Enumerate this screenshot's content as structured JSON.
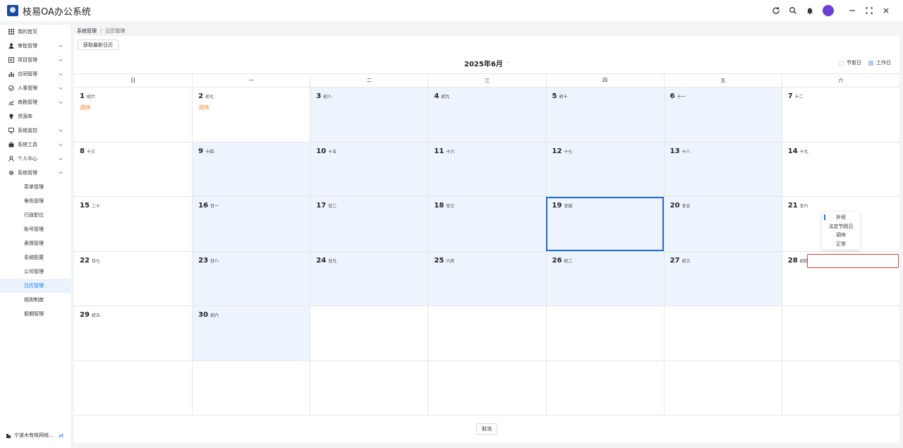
{
  "app": {
    "title": "枝易OA办公系统",
    "logo_icon": "app-logo-icon"
  },
  "topbar": {
    "icons": [
      "refresh-icon",
      "search-icon",
      "bell-icon",
      "user-avatar",
      "minimize-icon",
      "maximize-icon",
      "close-icon"
    ]
  },
  "sidebar": {
    "items": [
      {
        "label": "我的首页",
        "icon": "grid-icon",
        "expandable": false
      },
      {
        "label": "审批管理",
        "icon": "user-icon",
        "expandable": true
      },
      {
        "label": "项目管理",
        "icon": "project-icon",
        "expandable": true
      },
      {
        "label": "合同管理",
        "icon": "chart-icon",
        "expandable": true
      },
      {
        "label": "人事管理",
        "icon": "check-circle-icon",
        "expandable": true
      },
      {
        "label": "商務管理",
        "icon": "growth-chart-icon",
        "expandable": true
      },
      {
        "label": "资源库",
        "icon": "bulb-icon",
        "expandable": false
      },
      {
        "label": "系统监控",
        "icon": "monitor-icon",
        "expandable": true
      },
      {
        "label": "系统工具",
        "icon": "toolbox-icon",
        "expandable": true
      },
      {
        "label": "个人中心",
        "icon": "person-icon",
        "expandable": true
      },
      {
        "label": "系统管理",
        "icon": "gear-icon",
        "expandable": true,
        "expanded": true
      }
    ],
    "sub_items": [
      "菜单管理",
      "角色管理",
      "行政职位",
      "账号管理",
      "表情管理",
      "系统配置",
      "公司管理",
      "日历管理",
      "规则制度",
      "假期管理"
    ],
    "active_sub": "日历管理",
    "footer": {
      "company": "宁波木有枝网络...",
      "icon": "swap-icon"
    }
  },
  "breadcrumb": {
    "parent": "系统管理",
    "separator": "/",
    "current": "日历管理"
  },
  "toolbar": {
    "fetch_label": "获取最新日历"
  },
  "calendar": {
    "month_label": "2025年6月",
    "legend": {
      "holiday": "节假日",
      "workday": "工作日"
    },
    "colors": {
      "workday": "#eef4fd",
      "legend_workday": "#aecbf0",
      "selected_border": "#1a6fd6",
      "mark_text": "#f08c3a",
      "red_box": "#e53935",
      "active_blue": "#1677ff"
    },
    "weekdays": [
      "日",
      "一",
      "二",
      "三",
      "四",
      "五",
      "六"
    ],
    "rows": [
      [
        {
          "day": "1",
          "lunar": "初六",
          "mark": "调休",
          "type": "off"
        },
        {
          "day": "2",
          "lunar": "初七",
          "mark": "调休",
          "type": "off"
        },
        {
          "day": "3",
          "lunar": "初八",
          "type": "work"
        },
        {
          "day": "4",
          "lunar": "初九",
          "type": "work"
        },
        {
          "day": "5",
          "lunar": "初十",
          "type": "work"
        },
        {
          "day": "6",
          "lunar": "十一",
          "type": "work"
        },
        {
          "day": "7",
          "lunar": "十二",
          "type": "off"
        }
      ],
      [
        {
          "day": "8",
          "lunar": "十三",
          "type": "off"
        },
        {
          "day": "9",
          "lunar": "十四",
          "type": "work"
        },
        {
          "day": "10",
          "lunar": "十五",
          "type": "work"
        },
        {
          "day": "11",
          "lunar": "十六",
          "type": "work"
        },
        {
          "day": "12",
          "lunar": "十七",
          "type": "work"
        },
        {
          "day": "13",
          "lunar": "十八",
          "type": "work"
        },
        {
          "day": "14",
          "lunar": "十九",
          "type": "off"
        }
      ],
      [
        {
          "day": "15",
          "lunar": "二十",
          "type": "off"
        },
        {
          "day": "16",
          "lunar": "廿一",
          "type": "work"
        },
        {
          "day": "17",
          "lunar": "廿二",
          "type": "work"
        },
        {
          "day": "18",
          "lunar": "廿三",
          "type": "work"
        },
        {
          "day": "19",
          "lunar": "廿四",
          "type": "work",
          "selected": true
        },
        {
          "day": "20",
          "lunar": "廿五",
          "type": "work"
        },
        {
          "day": "21",
          "lunar": "廿六",
          "type": "off"
        }
      ],
      [
        {
          "day": "22",
          "lunar": "廿七",
          "type": "off"
        },
        {
          "day": "23",
          "lunar": "廿八",
          "type": "work"
        },
        {
          "day": "24",
          "lunar": "廿九",
          "type": "work"
        },
        {
          "day": "25",
          "lunar": "六月",
          "type": "work"
        },
        {
          "day": "26",
          "lunar": "初二",
          "type": "work"
        },
        {
          "day": "27",
          "lunar": "初三",
          "type": "work"
        },
        {
          "day": "28",
          "lunar": "初四",
          "type": "off"
        }
      ],
      [
        {
          "day": "29",
          "lunar": "初五",
          "type": "off"
        },
        {
          "day": "30",
          "lunar": "初六",
          "type": "work"
        },
        {
          "day": "",
          "lunar": "",
          "type": "off"
        },
        {
          "day": "",
          "lunar": "",
          "type": "off"
        },
        {
          "day": "",
          "lunar": "",
          "type": "off"
        },
        {
          "day": "",
          "lunar": "",
          "type": "off"
        },
        {
          "day": "",
          "lunar": "",
          "type": "off"
        }
      ],
      [
        {
          "day": "",
          "lunar": "",
          "type": "off"
        },
        {
          "day": "",
          "lunar": "",
          "type": "off"
        },
        {
          "day": "",
          "lunar": "",
          "type": "off"
        },
        {
          "day": "",
          "lunar": "",
          "type": "off"
        },
        {
          "day": "",
          "lunar": "",
          "type": "off"
        },
        {
          "day": "",
          "lunar": "",
          "type": "off"
        },
        {
          "day": "",
          "lunar": "",
          "type": "off"
        }
      ]
    ]
  },
  "day_type_dropdown": {
    "options": [
      "补班",
      "法定节假日",
      "调休",
      "正常"
    ],
    "current": "补班"
  },
  "footer": {
    "cancel_label": "取消"
  }
}
